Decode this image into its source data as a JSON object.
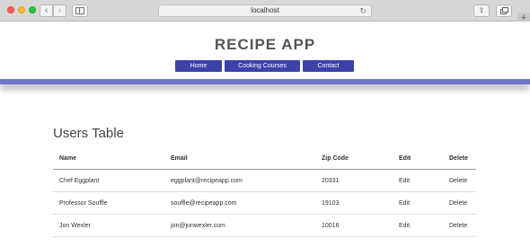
{
  "browser": {
    "url": "localhost",
    "back_icon": "‹",
    "forward_icon": "›",
    "reload_icon": "↻",
    "share_icon": "⇧",
    "new_tab_icon": "+"
  },
  "header": {
    "title": "RECIPE APP",
    "nav": [
      {
        "label": "Home"
      },
      {
        "label": "Cooking Courses"
      },
      {
        "label": "Contact"
      }
    ],
    "accent_color": "#3c42aa",
    "band_color": "#6c76c8"
  },
  "main": {
    "section_title": "Users Table",
    "columns": [
      "Name",
      "Email",
      "Zip Code",
      "Edit",
      "Delete"
    ],
    "rows": [
      {
        "name": "Chef Eggplant",
        "email": "eggplant@recipeapp.com",
        "zip": "20331",
        "edit": "Edit",
        "delete": "Delete"
      },
      {
        "name": "Professor Souffle",
        "email": "souffle@recipeapp.com",
        "zip": "19103",
        "edit": "Edit",
        "delete": "Delete"
      },
      {
        "name": "Jon Wexler",
        "email": "jon@jonwexler.com",
        "zip": "10016",
        "edit": "Edit",
        "delete": "Delete"
      }
    ]
  }
}
